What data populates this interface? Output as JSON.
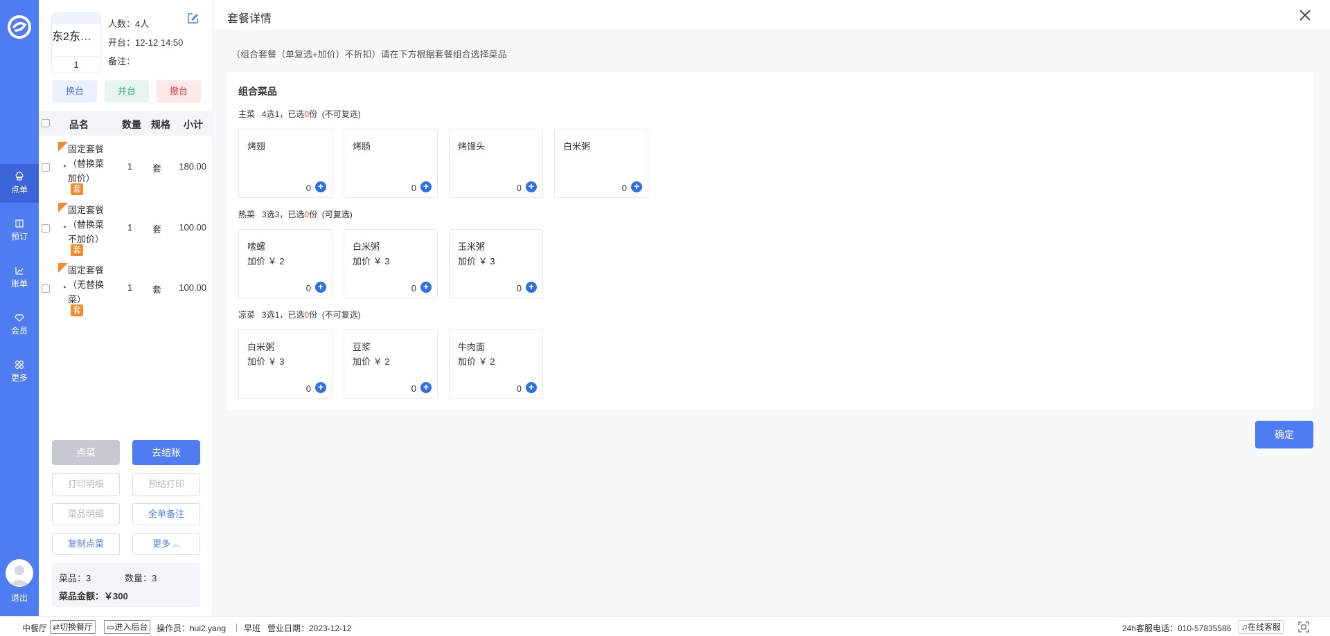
{
  "nav": {
    "items": [
      {
        "label": "点单",
        "icon": "chef-hat-icon"
      },
      {
        "label": "预订",
        "icon": "book-icon"
      },
      {
        "label": "账单",
        "icon": "chart-icon"
      },
      {
        "label": "会员",
        "icon": "diamond-icon"
      },
      {
        "label": "更多",
        "icon": "grid-icon"
      }
    ],
    "logout": "退出"
  },
  "order": {
    "table_name": "东2东…",
    "table_count": "1",
    "people": "人数：4人",
    "open_time": "开台：12-12 14:50",
    "remark": "备注：",
    "btn_change": "换台",
    "btn_merge": "并台",
    "btn_cancel": "撤台",
    "headers": {
      "name": "品名",
      "qty": "数量",
      "spec": "规格",
      "sub": "小计"
    },
    "rows": [
      {
        "name": "固定套餐（替换菜加价）",
        "tag": "套",
        "qty": "1",
        "unit": "套",
        "price": "180.00"
      },
      {
        "name": "固定套餐（替换菜不加价）",
        "tag": "套",
        "qty": "1",
        "unit": "套",
        "price": "100.00"
      },
      {
        "name": "固定套餐（无替换菜）",
        "tag": "套",
        "qty": "1",
        "unit": "套",
        "price": "100.00"
      }
    ],
    "actions": {
      "order_dish": "点菜",
      "checkout": "去结账",
      "print_detail": "打印明细",
      "pre_print": "预结打印",
      "dish_detail": "菜品明细",
      "all_remark": "全单备注",
      "copy_order": "复制点菜",
      "more": "更多"
    },
    "summary": {
      "dishes": "菜品：3",
      "quantity": "数量：3",
      "amount": "菜品金额：￥300"
    }
  },
  "dialog": {
    "title": "套餐详情",
    "hint": "（组合套餐（单复选+加价）不折扣）请在下方根据套餐组合选择菜品",
    "section_title": "组合菜品",
    "groups": [
      {
        "name": "主菜",
        "rule_prefix": "4选1，已选",
        "selected": "0",
        "rule_suffix": "份",
        "note": "(不可复选)",
        "items": [
          {
            "name": "烤翅",
            "price": "",
            "count": "0"
          },
          {
            "name": "烤肠",
            "price": "",
            "count": "0"
          },
          {
            "name": "烤馒头",
            "price": "",
            "count": "0"
          },
          {
            "name": "白米粥",
            "price": "",
            "count": "0"
          }
        ]
      },
      {
        "name": "热菜",
        "rule_prefix": "3选3，已选",
        "selected": "0",
        "rule_suffix": "份",
        "note": "(可复选)",
        "items": [
          {
            "name": "嗦螺",
            "price": "加价 ￥ 2",
            "count": "0"
          },
          {
            "name": "白米粥",
            "price": "加价 ￥ 3",
            "count": "0"
          },
          {
            "name": "玉米粥",
            "price": "加价 ￥ 3",
            "count": "0"
          }
        ]
      },
      {
        "name": "凉菜",
        "rule_prefix": "3选1，已选",
        "selected": "0",
        "rule_suffix": "份",
        "note": "(不可复选)",
        "items": [
          {
            "name": "白米粥",
            "price": "加价 ￥ 3",
            "count": "0"
          },
          {
            "name": "豆浆",
            "price": "加价 ￥ 2",
            "count": "0"
          },
          {
            "name": "牛肉面",
            "price": "加价 ￥ 2",
            "count": "0"
          }
        ]
      }
    ],
    "confirm": "确定"
  },
  "statusbar": {
    "hall": "中餐厅",
    "switch": "切换餐厅",
    "backend": "进入后台",
    "operator": "操作员：hui2.yang",
    "shift": "早班",
    "biz_date": "营业日期：2023-12-12",
    "hotline": "24h客服电话：010-57835586",
    "online": "在线客服"
  },
  "colors": {
    "primary": "#4f7cf0",
    "accent_orange": "#f08a2c",
    "danger": "#f04040"
  }
}
